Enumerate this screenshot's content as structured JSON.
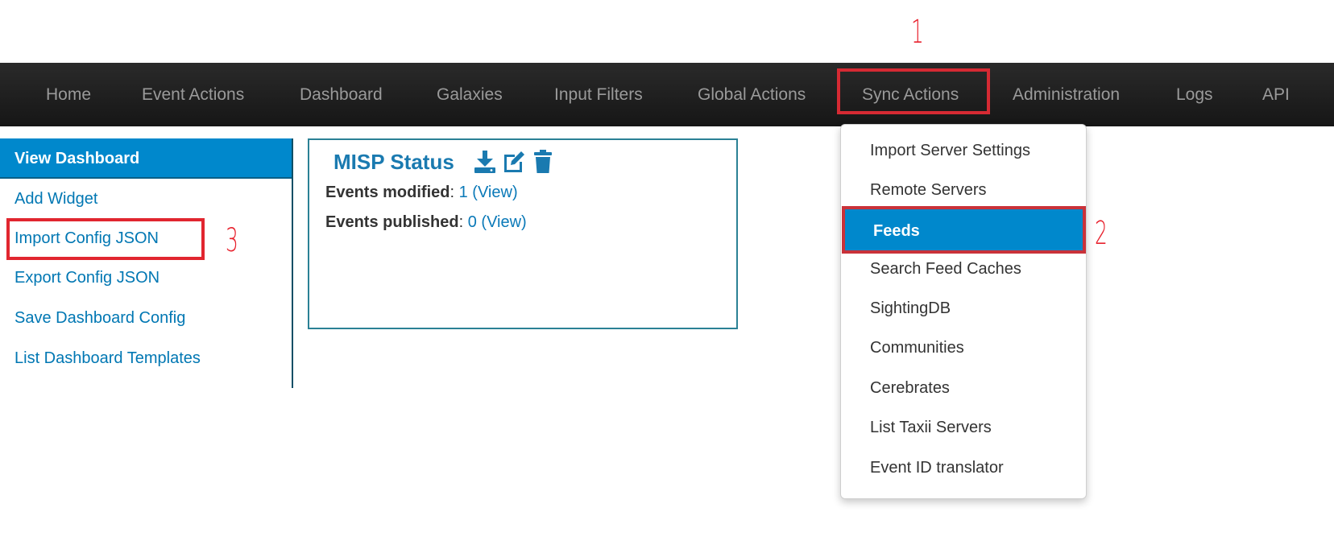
{
  "annotations": [
    "1",
    "2",
    "3"
  ],
  "navbar": {
    "items": [
      {
        "label": "Home"
      },
      {
        "label": "Event Actions"
      },
      {
        "label": "Dashboard"
      },
      {
        "label": "Galaxies"
      },
      {
        "label": "Input Filters"
      },
      {
        "label": "Global Actions"
      },
      {
        "label": "Sync Actions"
      },
      {
        "label": "Administration"
      },
      {
        "label": "Logs"
      },
      {
        "label": "API"
      }
    ]
  },
  "sidebar": {
    "items": [
      {
        "label": "View Dashboard",
        "active": true
      },
      {
        "label": "Add Widget"
      },
      {
        "label": "Import Config JSON"
      },
      {
        "label": "Export Config JSON"
      },
      {
        "label": "Save Dashboard Config"
      },
      {
        "label": "List Dashboard Templates"
      }
    ]
  },
  "widget": {
    "title": "MISP Status",
    "icons": [
      "download-icon",
      "edit-icon",
      "trash-icon"
    ],
    "lines": [
      {
        "label": "Events modified",
        "sep": ": ",
        "value": "1",
        "link": "(View)"
      },
      {
        "label": "Events published",
        "sep": ": ",
        "value": "0",
        "link": "(View)"
      }
    ]
  },
  "dropdown": {
    "items": [
      {
        "label": "Import Server Settings"
      },
      {
        "label": "Remote Servers"
      },
      {
        "label": "Feeds",
        "active": true
      },
      {
        "label": "Search Feed Caches"
      },
      {
        "label": "SightingDB"
      },
      {
        "label": "Communities"
      },
      {
        "label": "Cerebrates"
      },
      {
        "label": "List Taxii Servers"
      },
      {
        "label": "Event ID translator"
      }
    ]
  },
  "colors": {
    "accent": "#0088cc",
    "annotation": "#e8222e",
    "navbar": "#1c1c1c",
    "link": "#0077b3"
  }
}
